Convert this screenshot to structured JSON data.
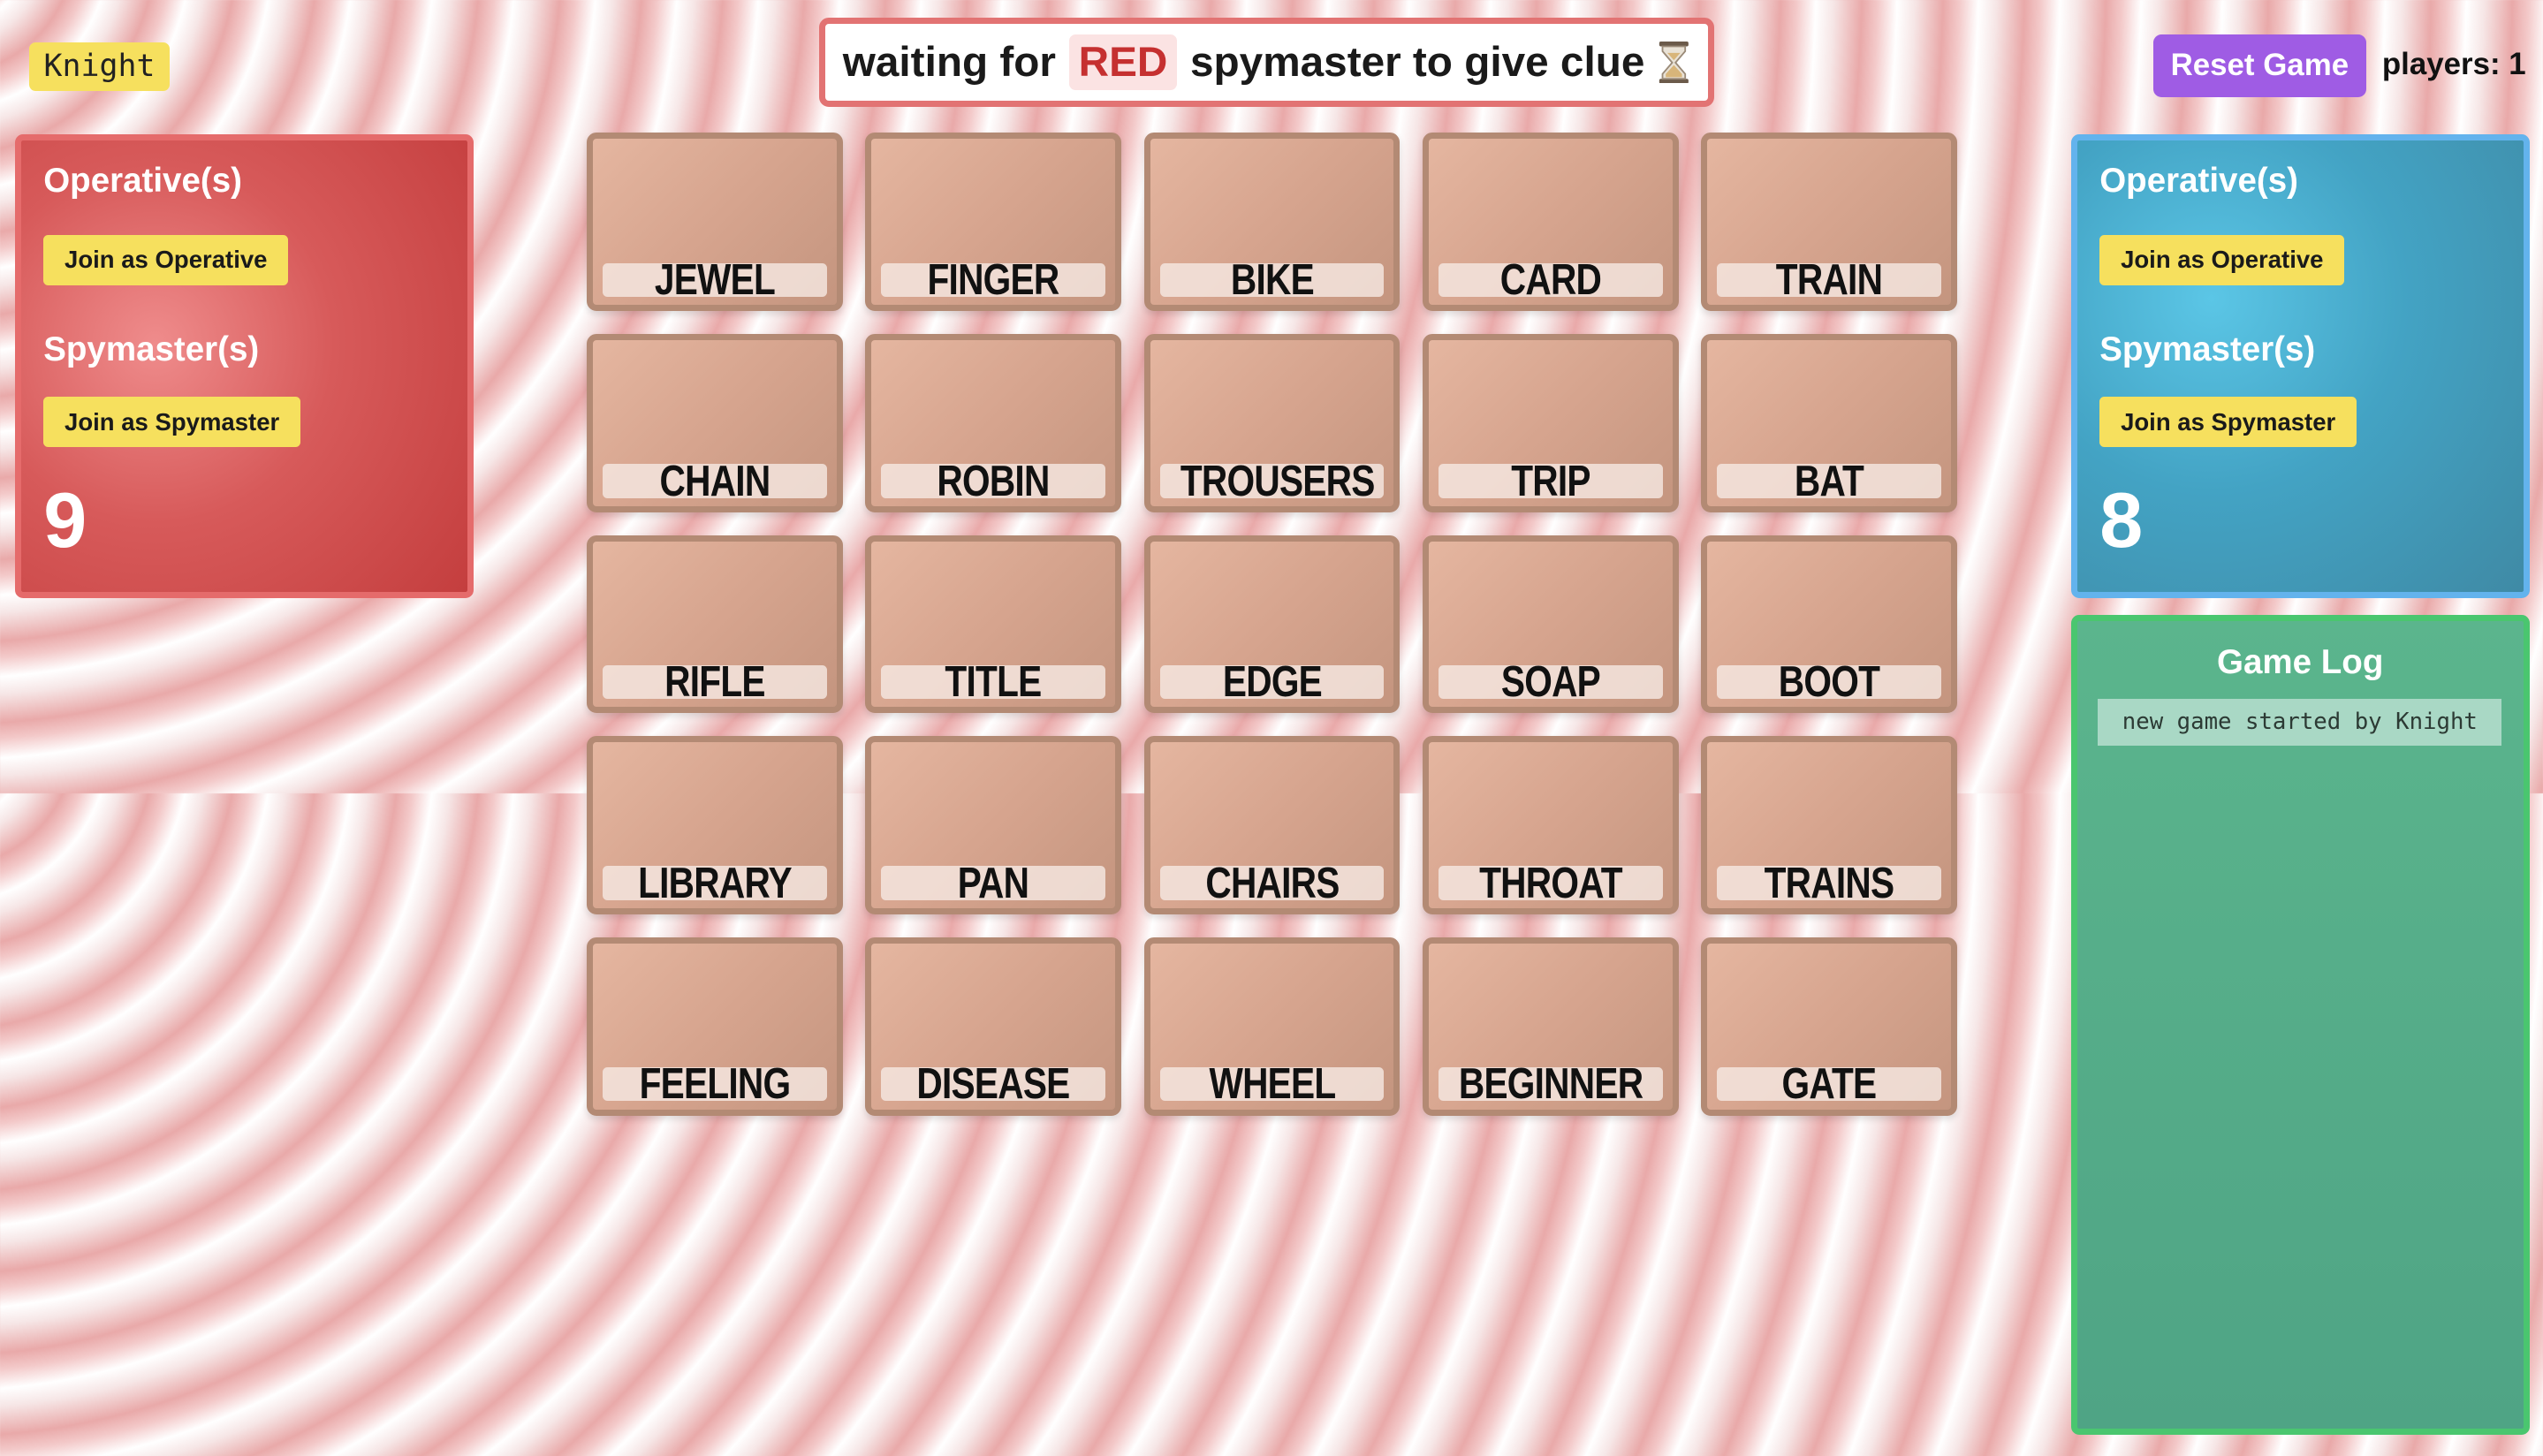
{
  "user": {
    "nickname": "Knight"
  },
  "status": {
    "prefix": "waiting for",
    "team": "RED",
    "suffix": "spymaster to give clue",
    "icon": "hourglass-icon"
  },
  "header": {
    "reset_label": "Reset Game",
    "players_label": "players: 1"
  },
  "teams": {
    "red": {
      "color": "#d75a5a",
      "operatives_heading": "Operative(s)",
      "join_operative_label": "Join as Operative",
      "spymasters_heading": "Spymaster(s)",
      "join_spymaster_label": "Join as Spymaster",
      "score": "9"
    },
    "blue": {
      "color": "#43a3c4",
      "operatives_heading": "Operative(s)",
      "join_operative_label": "Join as Operative",
      "spymasters_heading": "Spymaster(s)",
      "join_spymaster_label": "Join as Spymaster",
      "score": "8"
    }
  },
  "game_log": {
    "title": "Game Log",
    "entries": [
      "new game started by Knight"
    ]
  },
  "board": {
    "cards": [
      "JEWEL",
      "FINGER",
      "BIKE",
      "CARD",
      "TRAIN",
      "CHAIN",
      "ROBIN",
      "TROUSERS",
      "TRIP",
      "BAT",
      "RIFLE",
      "TITLE",
      "EDGE",
      "SOAP",
      "BOOT",
      "LIBRARY",
      "PAN",
      "CHAIRS",
      "THROAT",
      "TRAINS",
      "FEELING",
      "DISEASE",
      "WHEEL",
      "BEGINNER",
      "GATE"
    ]
  }
}
